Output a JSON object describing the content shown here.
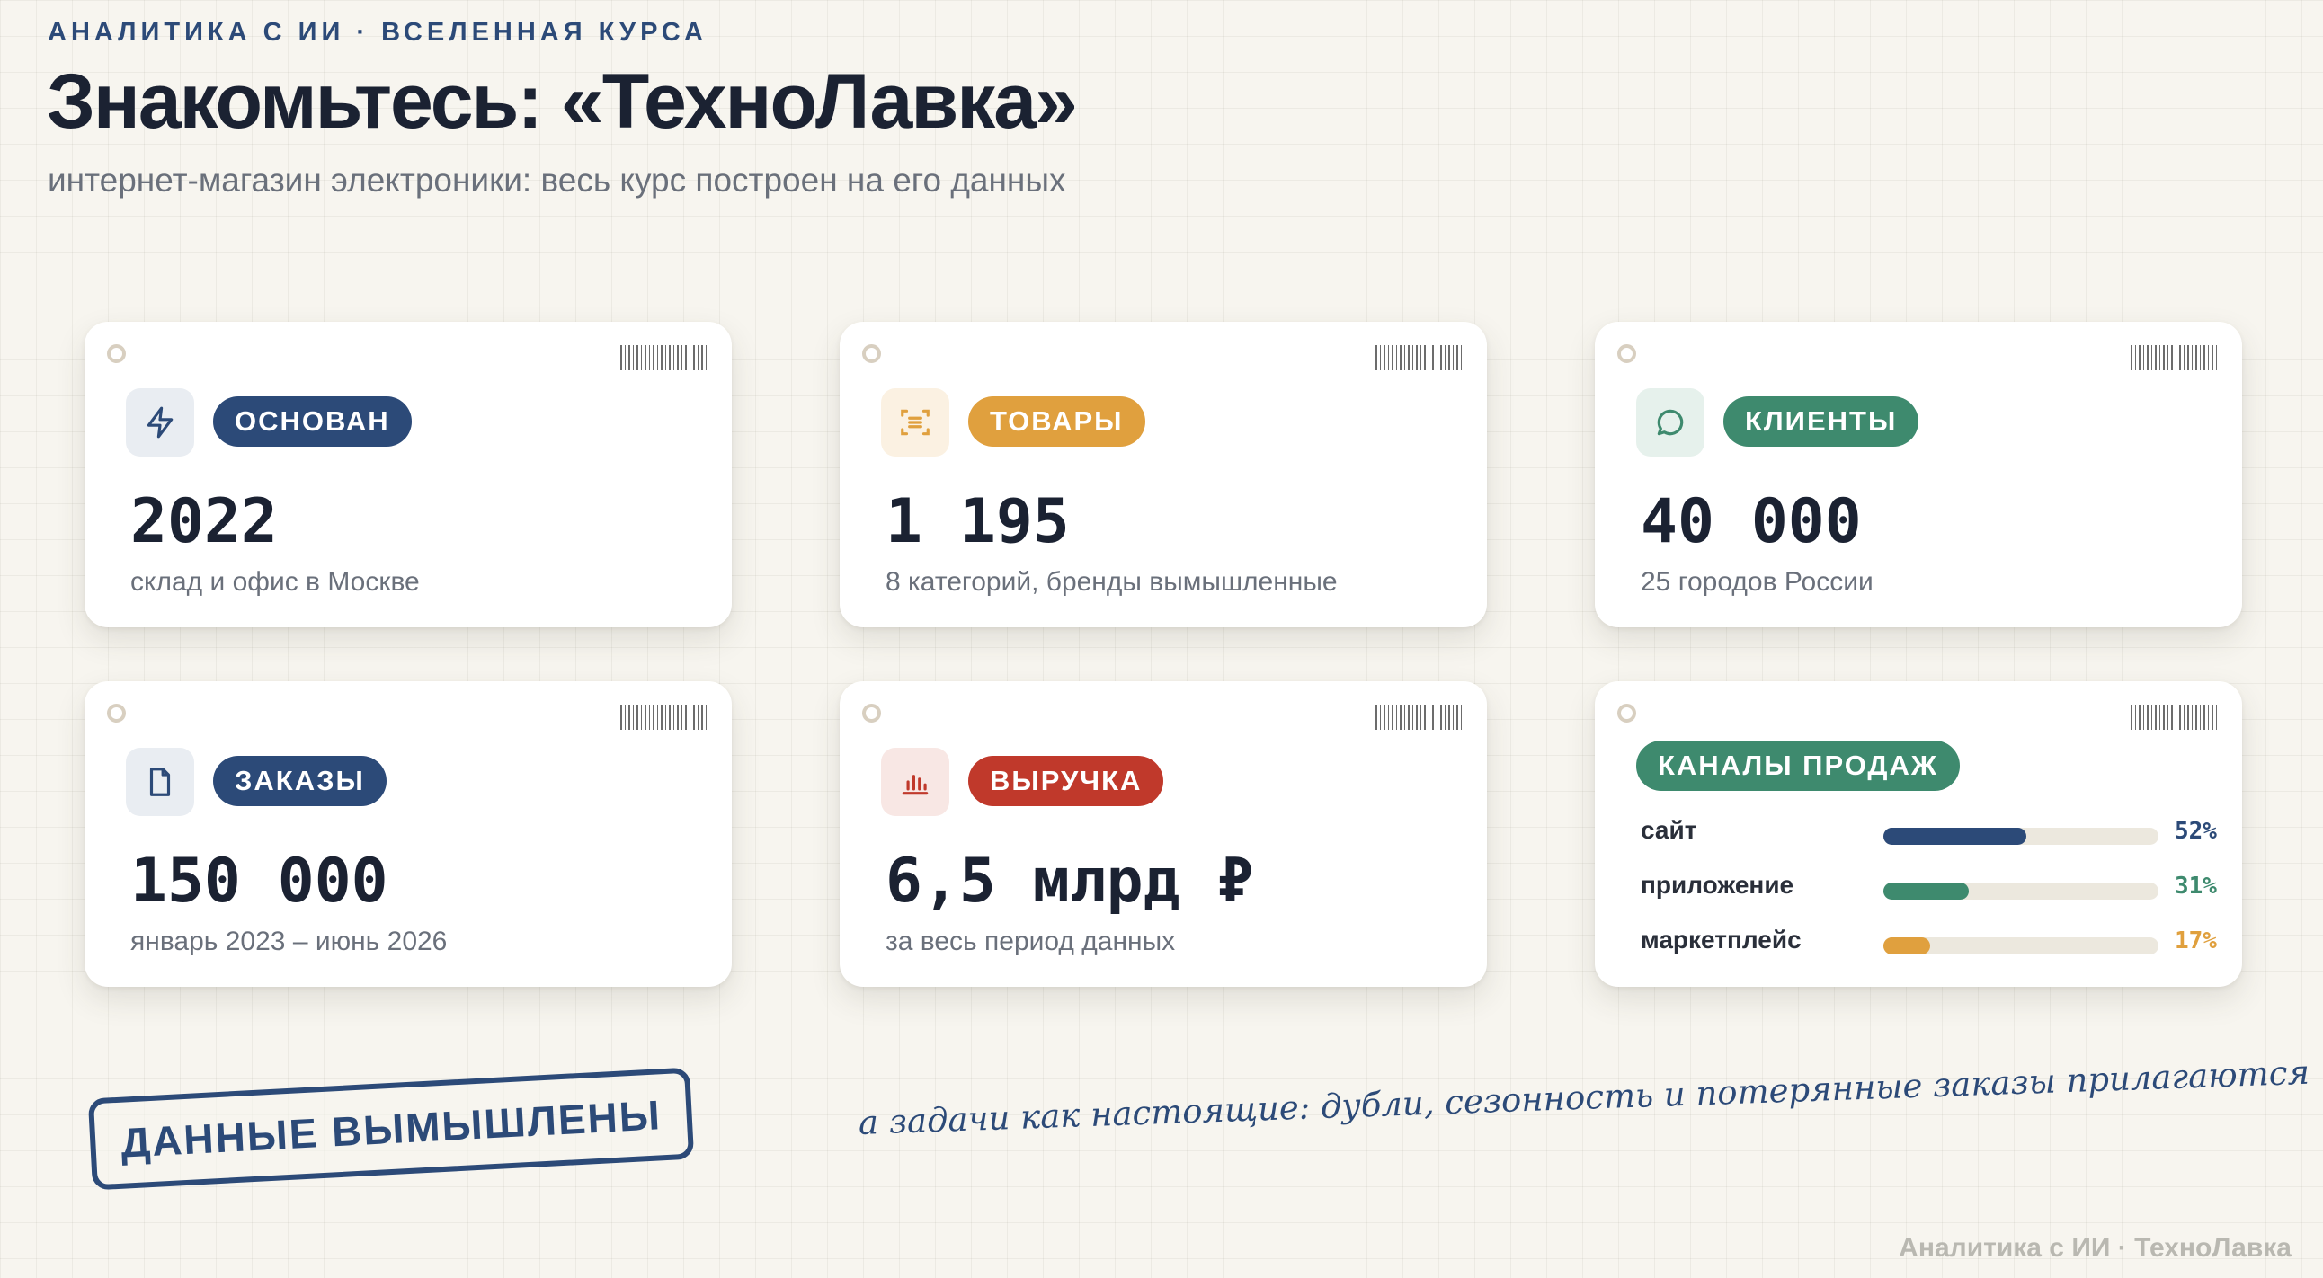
{
  "header": {
    "kicker": "АНАЛИТИКА С ИИ · ВСЕЛЕННАЯ КУРСА",
    "title": "Знакомьтесь: «ТехноЛавка»",
    "subtitle": "интернет-магазин электроники: весь курс построен на его данных"
  },
  "cards": [
    {
      "badge": "ОСНОВАН",
      "value": "2022",
      "caption": "склад и офис в Москве",
      "icon": "bolt-icon",
      "color": "#2c4a78"
    },
    {
      "badge": "ТОВАРЫ",
      "value": "1 195",
      "caption": "8 категорий, бренды вымышленные",
      "icon": "scan-icon",
      "color": "#e0a03e"
    },
    {
      "badge": "КЛИЕНТЫ",
      "value": "40 000",
      "caption": "25 городов России",
      "icon": "chat-bubble-icon",
      "color": "#3e8a6e"
    },
    {
      "badge": "ЗАКАЗЫ",
      "value": "150 000",
      "caption": "январь 2023 – июнь 2026",
      "icon": "document-icon",
      "color": "#2c4a78"
    },
    {
      "badge": "ВЫРУЧКА",
      "value": "6,5 млрд ₽",
      "caption": "за весь период данных",
      "icon": "bar-chart-icon",
      "color": "#c0392b"
    }
  ],
  "channels": {
    "title": "КАНАЛЫ ПРОДАЖ",
    "items": [
      {
        "label": "сайт",
        "percent": 52,
        "percent_label": "52%",
        "color": "#2c4a78"
      },
      {
        "label": "приложение",
        "percent": 31,
        "percent_label": "31%",
        "color": "#3e8a6e"
      },
      {
        "label": "маркетплейс",
        "percent": 17,
        "percent_label": "17%",
        "color": "#e0a03e"
      }
    ]
  },
  "stamp": "ДАННЫЕ ВЫМЫШЛЕНЫ",
  "note": "а задачи как настоящие: дубли, сезонность и потерянные заказы прилагаются",
  "footer": "Аналитика с ИИ · ТехноЛавка"
}
